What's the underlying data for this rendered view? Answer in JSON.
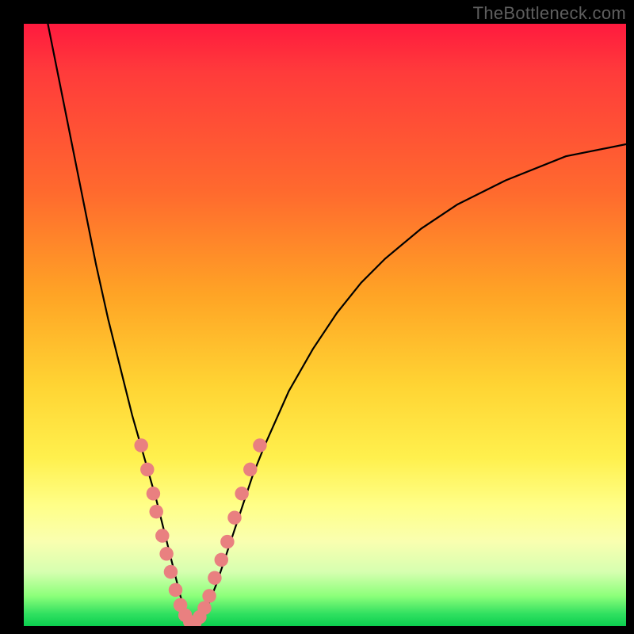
{
  "watermark": "TheBottleneck.com",
  "chart_data": {
    "type": "line",
    "title": "",
    "xlabel": "",
    "ylabel": "",
    "xlim": [
      0,
      100
    ],
    "ylim": [
      0,
      100
    ],
    "legend": false,
    "grid": false,
    "series": [
      {
        "name": "bottleneck-curve",
        "color": "#000000",
        "x": [
          4,
          6,
          8,
          10,
          12,
          14,
          16,
          18,
          20,
          22,
          24,
          25,
          26,
          27,
          28,
          29,
          30,
          32,
          34,
          36,
          38,
          40,
          44,
          48,
          52,
          56,
          60,
          66,
          72,
          80,
          90,
          100
        ],
        "y": [
          100,
          90,
          80,
          70,
          60,
          51,
          43,
          35,
          28,
          21,
          13,
          9,
          5,
          2,
          0.5,
          0.5,
          2,
          7,
          13,
          19,
          25,
          30,
          39,
          46,
          52,
          57,
          61,
          66,
          70,
          74,
          78,
          80
        ]
      }
    ],
    "markers": {
      "name": "sample-points",
      "color": "#e98080",
      "radius_pct": 1.15,
      "points": [
        {
          "x": 19.5,
          "y": 30
        },
        {
          "x": 20.5,
          "y": 26
        },
        {
          "x": 21.5,
          "y": 22
        },
        {
          "x": 22.0,
          "y": 19
        },
        {
          "x": 23.0,
          "y": 15
        },
        {
          "x": 23.7,
          "y": 12
        },
        {
          "x": 24.4,
          "y": 9
        },
        {
          "x": 25.2,
          "y": 6
        },
        {
          "x": 26.0,
          "y": 3.5
        },
        {
          "x": 26.8,
          "y": 1.8
        },
        {
          "x": 27.6,
          "y": 0.7
        },
        {
          "x": 28.4,
          "y": 0.6
        },
        {
          "x": 29.2,
          "y": 1.5
        },
        {
          "x": 30.0,
          "y": 3
        },
        {
          "x": 30.8,
          "y": 5
        },
        {
          "x": 31.7,
          "y": 8
        },
        {
          "x": 32.8,
          "y": 11
        },
        {
          "x": 33.8,
          "y": 14
        },
        {
          "x": 35.0,
          "y": 18
        },
        {
          "x": 36.2,
          "y": 22
        },
        {
          "x": 37.6,
          "y": 26
        },
        {
          "x": 39.2,
          "y": 30
        }
      ]
    }
  }
}
